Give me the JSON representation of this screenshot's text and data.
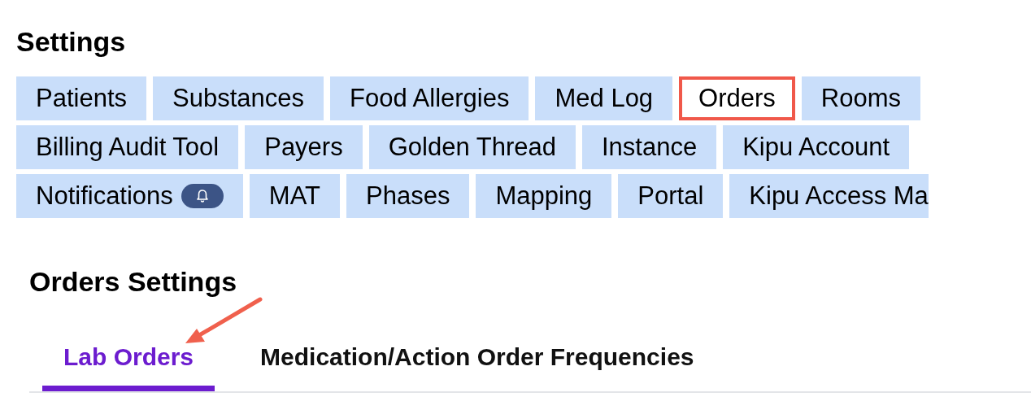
{
  "title": "Settings",
  "tab_rows": [
    [
      {
        "label": "Patients",
        "selected": false
      },
      {
        "label": "Substances",
        "selected": false
      },
      {
        "label": "Food Allergies",
        "selected": false
      },
      {
        "label": "Med Log",
        "selected": false
      },
      {
        "label": "Orders",
        "selected": true
      },
      {
        "label": "Rooms",
        "selected": false
      }
    ],
    [
      {
        "label": "Billing Audit Tool",
        "selected": false
      },
      {
        "label": "Payers",
        "selected": false
      },
      {
        "label": "Golden Thread",
        "selected": false
      },
      {
        "label": "Instance",
        "selected": false
      },
      {
        "label": "Kipu Account",
        "selected": false
      }
    ],
    [
      {
        "label": "Notifications",
        "selected": false,
        "kind": "bell"
      },
      {
        "label": "MAT",
        "selected": false
      },
      {
        "label": "Phases",
        "selected": false
      },
      {
        "label": "Mapping",
        "selected": false
      },
      {
        "label": "Portal",
        "selected": false
      },
      {
        "label": "Kipu Access Ma",
        "selected": false
      }
    ]
  ],
  "section_title": "Orders Settings",
  "sub_tabs": [
    {
      "label": "Lab Orders",
      "selected": true
    },
    {
      "label": "Medication/Action Order Frequencies",
      "selected": false
    }
  ]
}
